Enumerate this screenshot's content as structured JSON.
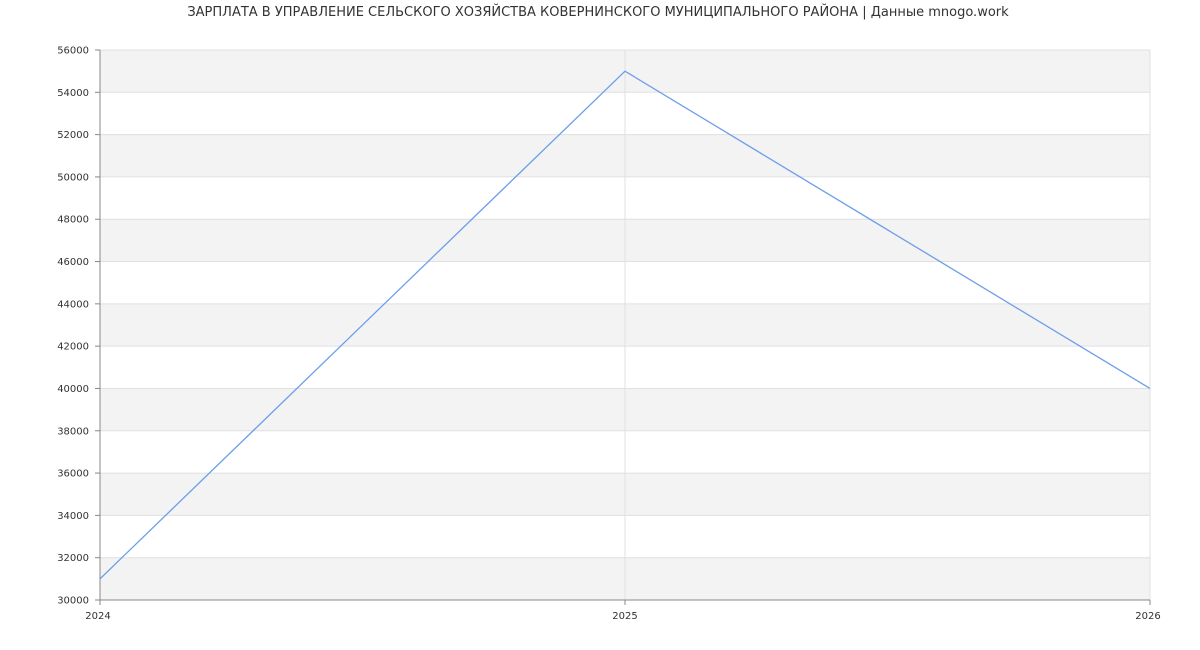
{
  "chart_data": {
    "type": "line",
    "title": "ЗАРПЛАТА В УПРАВЛЕНИЕ СЕЛЬСКОГО ХОЗЯЙСТВА КОВЕРНИНСКОГО МУНИЦИПАЛЬНОГО РАЙОНА | Данные mnogo.work",
    "xlabel": "",
    "ylabel": "",
    "x": [
      2024,
      2025,
      2026
    ],
    "series": [
      {
        "values": [
          31000,
          55000,
          40000
        ]
      }
    ],
    "xlim": [
      2024,
      2026
    ],
    "ylim": [
      30000,
      56000
    ],
    "yticks": [
      30000,
      32000,
      34000,
      36000,
      38000,
      40000,
      42000,
      44000,
      46000,
      48000,
      50000,
      52000,
      54000,
      56000
    ],
    "xticks": [
      2024,
      2025,
      2026
    ],
    "grid": true,
    "colors": {
      "line": "#6d9eeb",
      "band": "#f3f3f3",
      "grid": "#e0e0e0",
      "axis": "#888888"
    }
  }
}
